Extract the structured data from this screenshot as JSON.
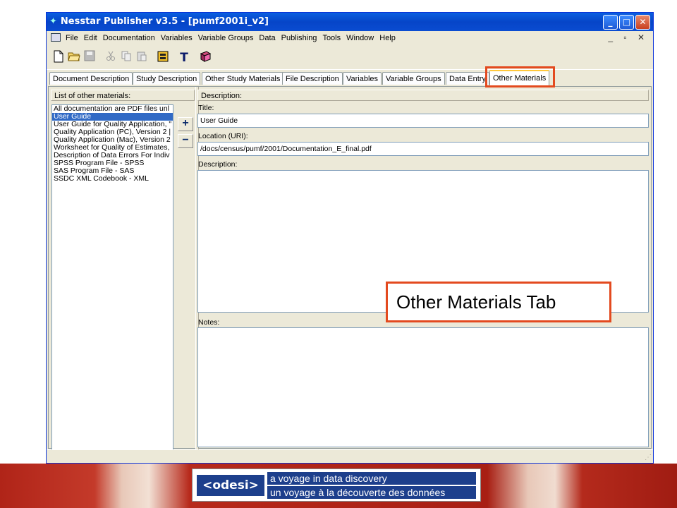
{
  "window": {
    "title": "Nesstar Publisher v3.5 - [pumf2001i_v2]",
    "controls": {
      "minimize": "_",
      "maximize": "□",
      "close": "✕"
    }
  },
  "menu": {
    "items": [
      "File",
      "Edit",
      "Documentation",
      "Variables",
      "Variable Groups",
      "Data",
      "Publishing",
      "Tools",
      "Window",
      "Help"
    ],
    "mdi_controls": "_ ▫ ✕"
  },
  "toolbar": {
    "icons": [
      "new-icon",
      "open-icon",
      "save-icon",
      "cut-icon",
      "copy-icon",
      "paste-icon",
      "export-icon",
      "text-icon",
      "book-icon"
    ],
    "text_tool_label": "T"
  },
  "tabs": [
    {
      "label": "Document Description"
    },
    {
      "label": "Study Description"
    },
    {
      "label": "Other Study Materials"
    },
    {
      "label": "File Description"
    },
    {
      "label": "Variables"
    },
    {
      "label": "Variable Groups"
    },
    {
      "label": "Data Entry"
    },
    {
      "label": "Other Materials",
      "active": true
    }
  ],
  "left_panel": {
    "header": "List of other materials:",
    "items": [
      "All documentation are PDF files unl",
      "User Guide",
      "User Guide for Quality Application, \"",
      "Quality Application (PC), Version 2 |",
      "Quality Application (Mac), Version 2",
      "Worksheet for Quality of Estimates,",
      "Description of Data Errors For Indiv",
      "SPSS Program File - SPSS",
      "SAS Program File - SAS",
      "SSDC XML Codebook - XML"
    ],
    "selected_index": 1,
    "add_label": "+",
    "remove_label": "−"
  },
  "right_panel": {
    "header": "Description:",
    "title_label": "Title:",
    "title_value": "User Guide",
    "location_label": "Location (URI):",
    "location_value": "/docs/census/pumf/2001/Documentation_E_final.pdf",
    "description_label": "Description:",
    "notes_label": "Notes:"
  },
  "callout": {
    "text": "Other Materials Tab"
  },
  "footer": {
    "logo_mark": "<odesi>",
    "line1": "a voyage in data discovery",
    "line2": "un voyage à la découverte des données"
  },
  "colors": {
    "accent": "#e34a1f",
    "selection": "#316ac5",
    "title_bar": "#0a5fe0"
  }
}
